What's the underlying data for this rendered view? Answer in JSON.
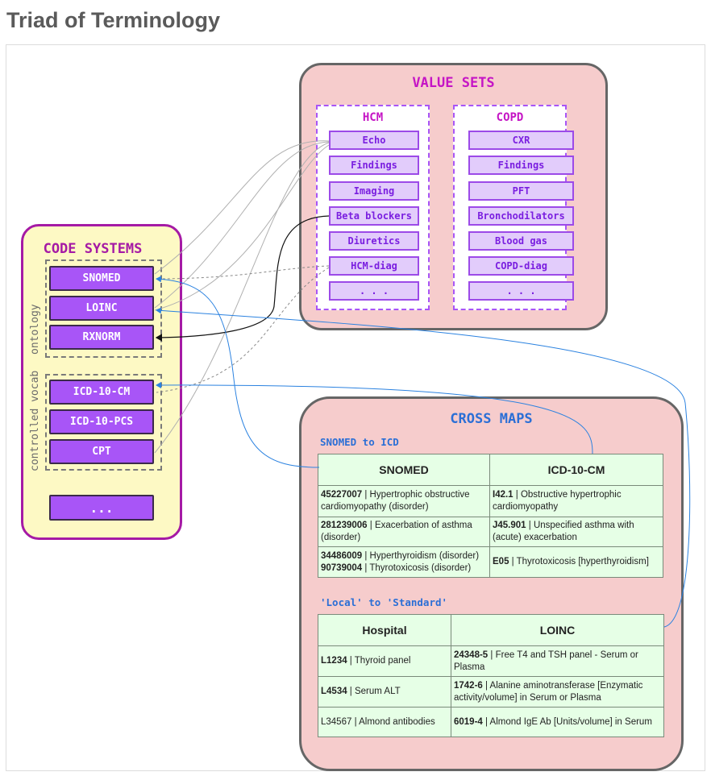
{
  "title": "Triad of Terminology",
  "code_systems": {
    "title": "CODE SYSTEMS",
    "ontology_label": "ontology",
    "controlled_label": "controlled vocab",
    "ontology": [
      "SNOMED",
      "LOINC",
      "RXNORM"
    ],
    "controlled": [
      "ICD-10-CM",
      "ICD-10-PCS",
      "CPT"
    ],
    "more": "..."
  },
  "value_sets": {
    "title": "VALUE SETS",
    "hcm": {
      "title": "HCM",
      "items": [
        "Echo",
        "Findings",
        "Imaging",
        "Beta blockers",
        "Diuretics",
        "HCM-diag",
        ". . ."
      ]
    },
    "copd": {
      "title": "COPD",
      "items": [
        "CXR",
        "Findings",
        "PFT",
        "Bronchodilators",
        "Blood gas",
        "COPD-diag",
        ". . ."
      ]
    }
  },
  "cross_maps": {
    "title": "CROSS MAPS",
    "snomed_icd": {
      "subtitle": "SNOMED to ICD",
      "headers": [
        "SNOMED",
        "ICD-10-CM"
      ],
      "rows": [
        {
          "a": [
            {
              "code": "45227007",
              "text": " | Hypertrophic obstructive cardiomyopathy (disorder)"
            }
          ],
          "b": [
            {
              "code": "I42.1",
              "text": " | Obstructive hypertrophic cardiomyopathy"
            }
          ]
        },
        {
          "a": [
            {
              "code": "281239006",
              "text": " | Exacerbation of asthma (disorder)"
            }
          ],
          "b": [
            {
              "code": "J45.901",
              "text": " | Unspecified asthma with (acute) exacerbation"
            }
          ]
        },
        {
          "a": [
            {
              "code": "34486009",
              "text": " | Hyperthyroidism (disorder)"
            },
            {
              "code": "90739004",
              "text": " | Thyrotoxicosis (disorder)"
            }
          ],
          "b": [
            {
              "code": "E05",
              "text": " | Thyrotoxicosis [hyperthyroidism]"
            }
          ]
        }
      ]
    },
    "local_standard": {
      "subtitle": "'Local' to 'Standard'",
      "headers": [
        "Hospital",
        "LOINC"
      ],
      "rows": [
        {
          "a": [
            {
              "code": "L1234",
              "text": " | Thyroid panel"
            }
          ],
          "b": [
            {
              "code": "24348-5",
              "text": " | Free T4 and TSH panel - Serum or Plasma"
            }
          ]
        },
        {
          "a": [
            {
              "code": "L4534",
              "text": " | Serum ALT"
            }
          ],
          "b": [
            {
              "code": "1742-6",
              "text": " | Alanine aminotransferase [Enzymatic activity/volume] in Serum or Plasma"
            }
          ]
        },
        {
          "a": [
            {
              "code": "",
              "text": "L34567 | Almond antibodies"
            }
          ],
          "b": [
            {
              "code": "6019-4",
              "text": " | Almond IgE Ab [Units/volume] in Serum"
            }
          ]
        }
      ]
    }
  },
  "colors": {
    "purple": "#a855f7",
    "magenta": "#a51aa5",
    "pink_panel": "#f6cccc",
    "yellow_panel": "#fdf9c4",
    "blue": "#2b6fd6",
    "green_table": "#e6ffe6"
  }
}
